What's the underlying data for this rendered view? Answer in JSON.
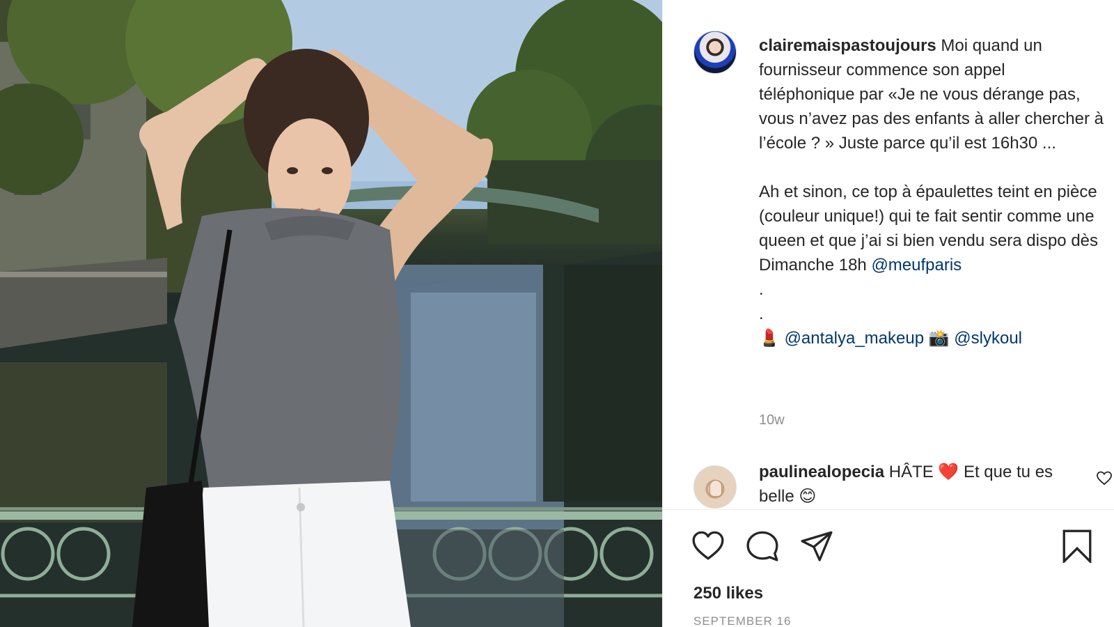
{
  "post": {
    "photo_alt": "",
    "author": {
      "username": "clairemaispastoujours"
    },
    "caption": {
      "line1": " Moi quand un fournisseur commence son appel téléphonique par «Je ne vous dérange pas, vous n’avez pas des enfants à aller chercher à l’école ? » Juste parce qu’il est 16h30 ...",
      "para2": "Ah et sinon, ce top à épaulettes teint en pièce (couleur unique!) qui te fait sentir comme une queen et que j’ai si bien vendu sera dispo dès Dimanche 18h ",
      "mention1": "@meufparis",
      "dot1": ".",
      "dot2": ".",
      "emoji1": "💄",
      "mention2": "@antalya_makeup",
      "emoji2": "📸",
      "mention3": "@slykoul"
    },
    "time_ago": "10w"
  },
  "comments": [
    {
      "username": "paulinealopecia",
      "text": " HÂTE ❤️ Et que tu es belle 😊"
    }
  ],
  "actions": {
    "like_icon": "heart-icon",
    "comment_icon": "comment-icon",
    "share_icon": "paper-plane-icon",
    "save_icon": "bookmark-icon"
  },
  "likes": "250 likes",
  "date": "SEPTEMBER 16",
  "colors": {
    "mention": "#00376b",
    "muted": "#8e8e8e",
    "text": "#262626",
    "heart": "#ed4956"
  }
}
